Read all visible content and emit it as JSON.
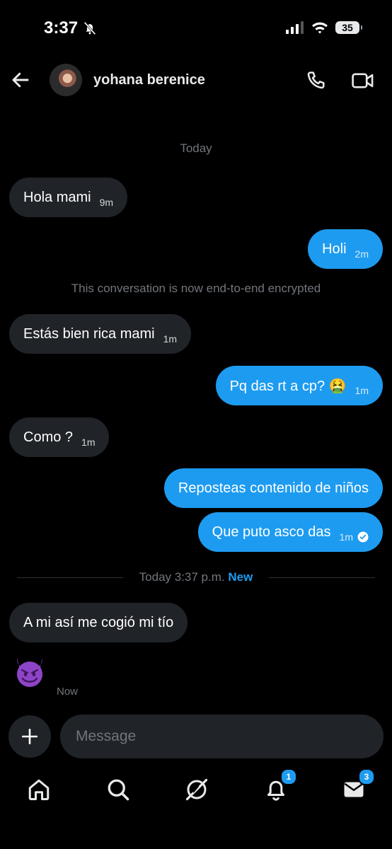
{
  "status_bar": {
    "time": "3:37",
    "battery": "35"
  },
  "header": {
    "contact_name": "yohana berenice"
  },
  "messages": {
    "day_label": "Today",
    "m1": {
      "text": "Hola mami",
      "time": "9m"
    },
    "m2": {
      "text": "Holi",
      "time": "2m"
    },
    "encryption_note": "This conversation is now end-to-end encrypted",
    "m3": {
      "text": "Estás bien rica mami",
      "time": "1m"
    },
    "m4": {
      "text": "Pq das rt a cp? 🤮",
      "time": "1m"
    },
    "m5": {
      "text": "Como ?",
      "time": "1m"
    },
    "m6": {
      "text": "Reposteas contenido de niños"
    },
    "m7": {
      "text": "Que puto asco das",
      "time": "1m"
    },
    "separator": {
      "label": "Today 3:37 p.m.",
      "new_label": "New"
    },
    "m8": {
      "text": "A mi así me cogió mi tío"
    },
    "m9": {
      "emoji": "😈",
      "time": "Now"
    }
  },
  "composer": {
    "placeholder": "Message"
  },
  "bottom_nav": {
    "items": [
      "home-icon",
      "search-icon",
      "grok-icon",
      "notifications-icon",
      "messages-icon"
    ],
    "notifications_badge": "1",
    "messages_badge": "3"
  },
  "colors": {
    "accent": "#1d9bf0",
    "incoming_bubble": "#202327",
    "background": "#000000"
  }
}
